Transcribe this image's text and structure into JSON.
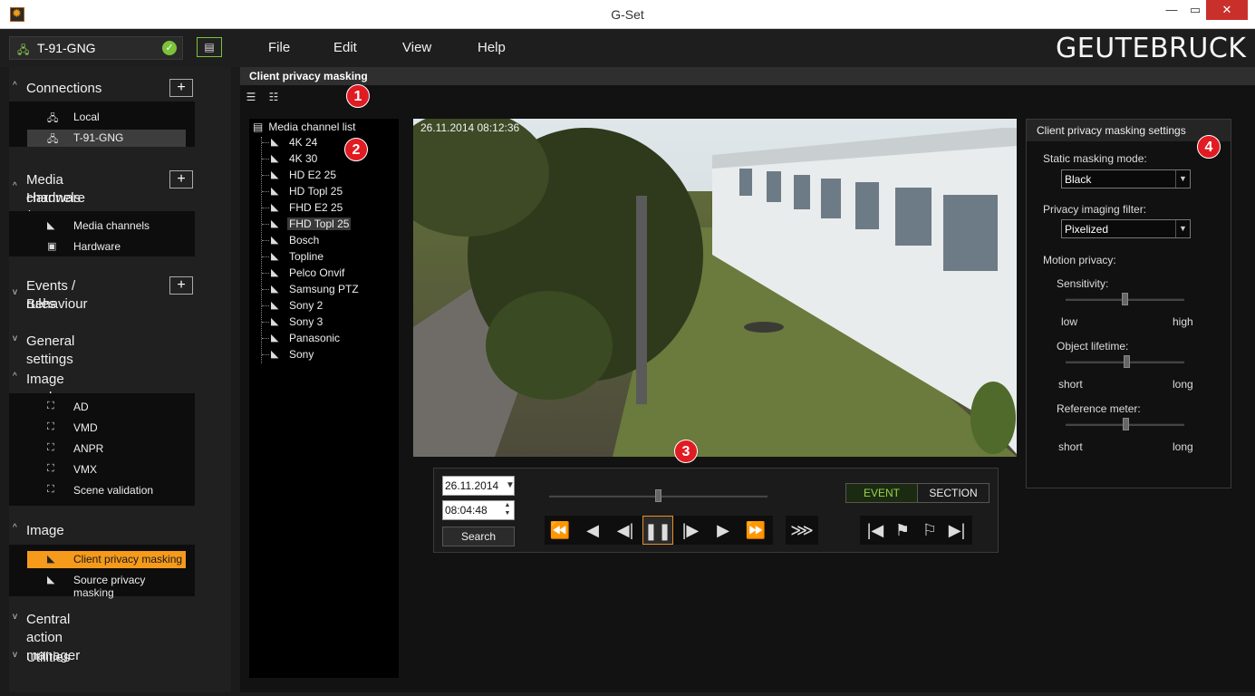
{
  "window": {
    "title": "G-Set"
  },
  "topbar": {
    "connection": "T-91-GNG",
    "menu": [
      "File",
      "Edit",
      "View",
      "Help"
    ],
    "logo": "GEUTEBRUCK"
  },
  "nav": {
    "sections": {
      "connections": {
        "label": "Connections",
        "items": [
          "Local",
          "T-91-GNG"
        ]
      },
      "media": {
        "label_line1": "Media channels /",
        "label_line2": "Hardware",
        "items": [
          "Media channels",
          "Hardware"
        ]
      },
      "events": {
        "label_line1": "Events / Behaviour",
        "label_line2": "rules"
      },
      "general": {
        "label": "General settings"
      },
      "analyzers": {
        "label": "Image analyzers",
        "items": [
          "AD",
          "VMD",
          "ANPR",
          "VMX",
          "Scene validation"
        ]
      },
      "processors": {
        "label": "Image processors",
        "items": [
          "Client privacy masking",
          "Source privacy masking"
        ]
      },
      "cam": {
        "label": "Central action manager"
      },
      "utilities": {
        "label": "Utilities"
      }
    }
  },
  "main": {
    "title": "Client privacy masking",
    "badges": [
      "1",
      "2",
      "3",
      "4"
    ],
    "tree": {
      "root": "Media channel list",
      "items": [
        "4K 24",
        "4K 30",
        "HD E2 25",
        "HD Topl 25",
        "FHD E2 25",
        "FHD Topl 25",
        "Bosch",
        "Topline",
        "Pelco Onvif",
        "Samsung PTZ",
        "Sony 2",
        "Sony 3",
        "Panasonic",
        "Sony"
      ],
      "selected_index": 5
    },
    "video": {
      "timestamp": "26.11.2014 08:12:36"
    },
    "playback": {
      "date": "26.11.2014",
      "time": "08:04:48",
      "search": "Search",
      "event": "EVENT",
      "section": "SECTION",
      "timeline_position": 0.5
    },
    "settings": {
      "title": "Client privacy masking settings",
      "static_mode_label": "Static masking mode:",
      "static_mode_value": "Black",
      "filter_label": "Privacy imaging filter:",
      "filter_value": "Pixelized",
      "motion_label": "Motion privacy:",
      "sensitivity_label": "Sensitivity:",
      "sensitivity_low": "low",
      "sensitivity_high": "high",
      "sensitivity_value": 0.5,
      "lifetime_label": "Object lifetime:",
      "lifetime_short": "short",
      "lifetime_long": "long",
      "lifetime_value": 0.5,
      "reference_label": "Reference meter:",
      "reference_short": "short",
      "reference_long": "long",
      "reference_value": 0.5
    }
  }
}
